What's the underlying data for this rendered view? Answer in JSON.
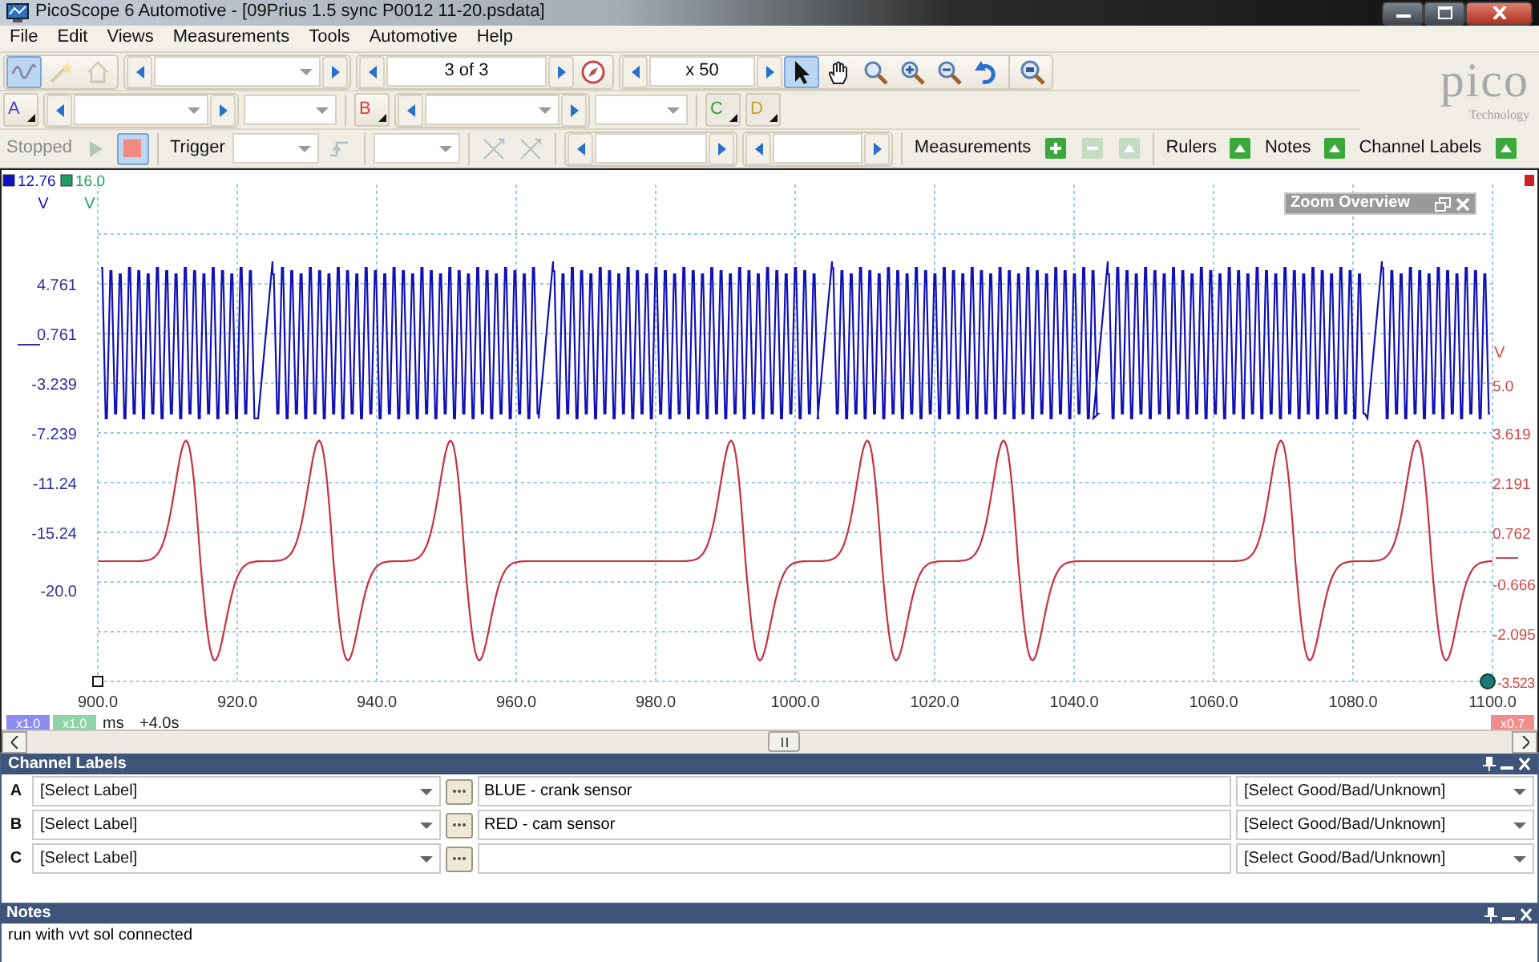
{
  "window": {
    "title": "PicoScope 6 Automotive - [09Prius 1.5 sync P0012 11-20.psdata]"
  },
  "menu": [
    "File",
    "Edit",
    "Views",
    "Measurements",
    "Tools",
    "Automotive",
    "Help"
  ],
  "toolbar_1": {
    "mode_buttons": [
      {
        "kind": "scope",
        "disabled": false
      },
      {
        "kind": "wand",
        "disabled": true
      },
      {
        "kind": "home",
        "disabled": true
      }
    ],
    "buffer": "3 of 3",
    "zoom_factor": "x 50",
    "view_tools": [
      {
        "kind": "pointer",
        "selected": true
      },
      {
        "kind": "hand",
        "selected": false
      },
      {
        "kind": "zoom",
        "selected": false
      },
      {
        "kind": "zoom-in",
        "selected": false
      },
      {
        "kind": "zoom-out",
        "selected": false
      },
      {
        "kind": "undo",
        "selected": false
      },
      {
        "kind": "overview",
        "selected": false
      }
    ]
  },
  "logo": {
    "wordmark": "pico",
    "tagline": "Technology"
  },
  "channel_buttons": [
    {
      "label": "A",
      "color": "#4040d0",
      "enabled": true
    },
    {
      "label": "B",
      "color": "#d04040",
      "enabled": true
    },
    {
      "label": "C",
      "color": "#30a030",
      "enabled": false
    },
    {
      "label": "D",
      "color": "#c8a020",
      "enabled": false
    }
  ],
  "toolbar_3": {
    "status": "Stopped",
    "trigger": "Trigger",
    "measurements": "Measurements",
    "measurement_buttons": [
      {
        "kind": "add",
        "disabled": false
      },
      {
        "kind": "remove",
        "disabled": true
      },
      {
        "kind": "edit",
        "disabled": true
      }
    ],
    "panels": [
      {
        "label": "Rulers",
        "on": true
      },
      {
        "label": "Notes",
        "on": true
      },
      {
        "label": "Channel Labels",
        "on": true
      }
    ]
  },
  "scope": {
    "top_readouts": [
      {
        "value": "12.76",
        "unit": "V",
        "color": "#1010c0"
      },
      {
        "value": "16.0",
        "unit": "V",
        "color": "#20a060"
      }
    ],
    "left_ticks": [
      "4.761",
      "0.761",
      "-3.239",
      "-7.239",
      "-11.24",
      "-15.24",
      "-20.0"
    ],
    "right_unit": "V",
    "right_ticks": [
      "5.0",
      "3.619",
      "2.191",
      "0.762",
      "-0.666",
      "-2.095",
      "-3.523"
    ],
    "x_ticks": [
      "900.0",
      "920.0",
      "940.0",
      "960.0",
      "980.0",
      "1000.0",
      "1020.0",
      "1040.0",
      "1060.0",
      "1080.0",
      "1100.0"
    ],
    "x_unit": "ms",
    "offset": "+4.0s",
    "left_badges": [
      {
        "label": "x1.0",
        "color": "#8c8cf0"
      },
      {
        "label": "x1.0",
        "color": "#8fd4a8"
      }
    ],
    "right_badges": [
      {
        "label": "x0.7",
        "color": "#f08c8c"
      }
    ],
    "zoom_overview": {
      "title": "Zoom Overview"
    }
  },
  "channel_labels": {
    "title": "Channel Labels",
    "rows": [
      {
        "channel": "A",
        "label": "[Select Label]",
        "description": "BLUE - crank sensor",
        "rating": "[Select Good/Bad/Unknown]"
      },
      {
        "channel": "B",
        "label": "[Select Label]",
        "description": "RED - cam sensor",
        "rating": "[Select Good/Bad/Unknown]"
      },
      {
        "channel": "C",
        "label": "[Select Label]",
        "rating": "[Select Good/Bad/Unknown]"
      }
    ]
  },
  "notes": {
    "title": "Notes",
    "text": "run with vvt sol connected"
  }
}
